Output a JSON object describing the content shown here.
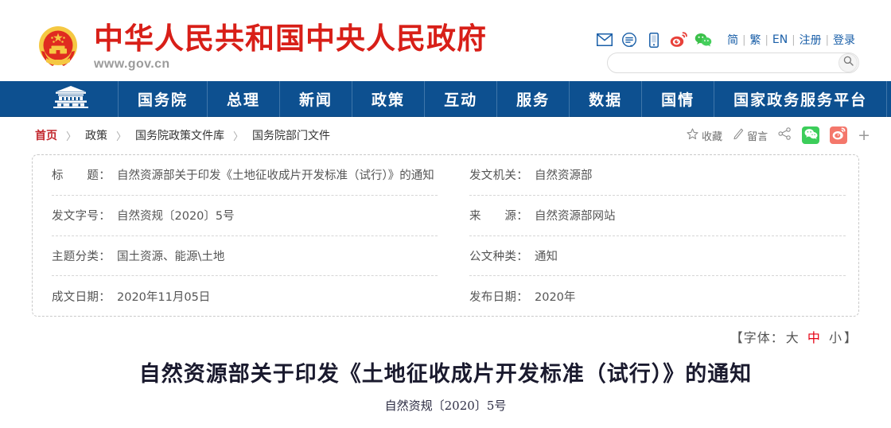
{
  "header": {
    "site_title": "中华人民共和国中央人民政府",
    "site_url": "www.gov.cn",
    "emblem_icon": "national-emblem-icon",
    "utility_icons": [
      {
        "name": "mail-icon",
        "label": "邮箱"
      },
      {
        "name": "message-icon",
        "label": "留言"
      },
      {
        "name": "mobile-icon",
        "label": "手机版"
      },
      {
        "name": "weibo-icon",
        "label": "微博"
      },
      {
        "name": "wechat-icon",
        "label": "微信"
      }
    ],
    "utility_links": [
      {
        "label": "简"
      },
      {
        "label": "繁"
      },
      {
        "label": "EN"
      },
      {
        "label": "注册"
      },
      {
        "label": "登录"
      }
    ],
    "separator": "|",
    "search": {
      "value": "",
      "placeholder": "",
      "button_icon": "search-icon"
    }
  },
  "nav": {
    "home_icon": "tiananmen-icon",
    "items": [
      {
        "label": "国务院"
      },
      {
        "label": "总理"
      },
      {
        "label": "新闻"
      },
      {
        "label": "政策"
      },
      {
        "label": "互动"
      },
      {
        "label": "服务"
      },
      {
        "label": "数据"
      },
      {
        "label": "国情"
      },
      {
        "label": "国家政务服务平台"
      }
    ]
  },
  "breadcrumb": {
    "separator": "〉",
    "items": [
      {
        "label": "首页"
      },
      {
        "label": "政策"
      },
      {
        "label": "国务院政策文件库"
      },
      {
        "label": "国务院部门文件"
      }
    ]
  },
  "actions": {
    "favorite": {
      "label": "收藏",
      "icon": "star-icon"
    },
    "comment": {
      "label": "留言",
      "icon": "pencil-icon"
    },
    "share": {
      "icon": "share-icon"
    },
    "wechat": {
      "icon": "wechat-icon"
    },
    "weibo": {
      "icon": "weibo-icon"
    },
    "more": {
      "label": "+",
      "icon": "plus-icon"
    }
  },
  "meta": {
    "left": [
      {
        "label": "标　　题：",
        "value": "自然资源部关于印发《土地征收成片开发标准（试行）》的通知"
      },
      {
        "label": "发文字号：",
        "value": "自然资规〔2020〕5号"
      },
      {
        "label": "主题分类：",
        "value": "国土资源、能源\\土地"
      },
      {
        "label": "成文日期：",
        "value": "2020年11月05日"
      }
    ],
    "right": [
      {
        "label": "发文机关：",
        "value": "自然资源部"
      },
      {
        "label": "来　　源：",
        "value": "自然资源部网站"
      },
      {
        "label": "公文种类：",
        "value": "通知"
      },
      {
        "label": "发布日期：",
        "value": "2020年"
      }
    ]
  },
  "font_picker": {
    "open_bracket": "【",
    "prefix": "字体：",
    "large": "大",
    "medium": "中",
    "small": "小",
    "close_bracket": "】",
    "active": "中"
  },
  "document": {
    "title": "自然资源部关于印发《土地征收成片开发标准（试行）》的通知",
    "subtitle": "自然资规〔2020〕5号"
  },
  "colors": {
    "brand_red": "#d81f18",
    "nav_blue": "#0d5090",
    "link_blue": "#1a5fa8",
    "crumb_active": "#c2272d",
    "font_active_red": "#e60012",
    "wechat_green": "#3ccd5a",
    "weibo_salmon": "#f4776b"
  }
}
